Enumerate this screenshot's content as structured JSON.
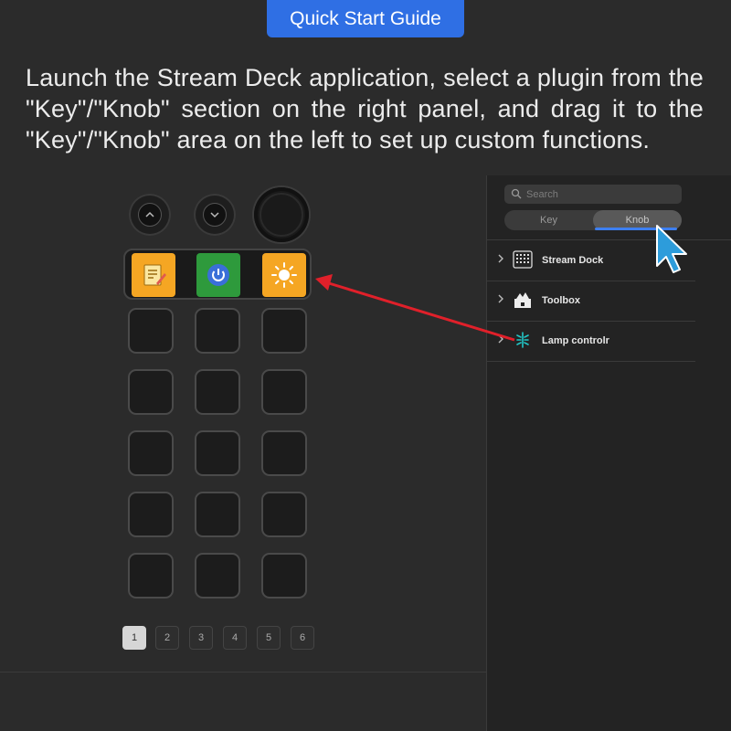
{
  "header": {
    "title": "Quick Start Guide",
    "instructions": "Launch the Stream Deck application, select a plugin from the \"Key\"/\"Knob\" section on the right panel, and drag it to the \"Key\"/\"Knob\" area on the left to set up custom functions."
  },
  "device": {
    "knob_buttons": [
      {
        "icon": "chevron-up-icon"
      },
      {
        "icon": "chevron-down-icon"
      }
    ],
    "dial": {
      "icon": "rotary-dial"
    },
    "active_keys": [
      {
        "icon": "notepad-icon",
        "color": "#f5a623"
      },
      {
        "icon": "power-icon",
        "color": "#2e9a3c"
      },
      {
        "icon": "brightness-icon",
        "color": "#f5a623"
      }
    ],
    "pages": [
      "1",
      "2",
      "3",
      "4",
      "5",
      "6"
    ],
    "active_page": "1"
  },
  "panel": {
    "search_placeholder": "Search",
    "tabs": [
      "Key",
      "Knob"
    ],
    "selected_tab": "Knob",
    "accent": "#3d7ff0",
    "categories": [
      {
        "label": "Stream Dock",
        "icon": "keypad-grid-icon"
      },
      {
        "label": "Toolbox",
        "icon": "toolbox-icon"
      },
      {
        "label": "Lamp controlr",
        "icon": "lamp-control-icon"
      }
    ]
  },
  "annotations": {
    "arrow_color": "#e0202a",
    "cursor_color": "#2d9cdb"
  }
}
